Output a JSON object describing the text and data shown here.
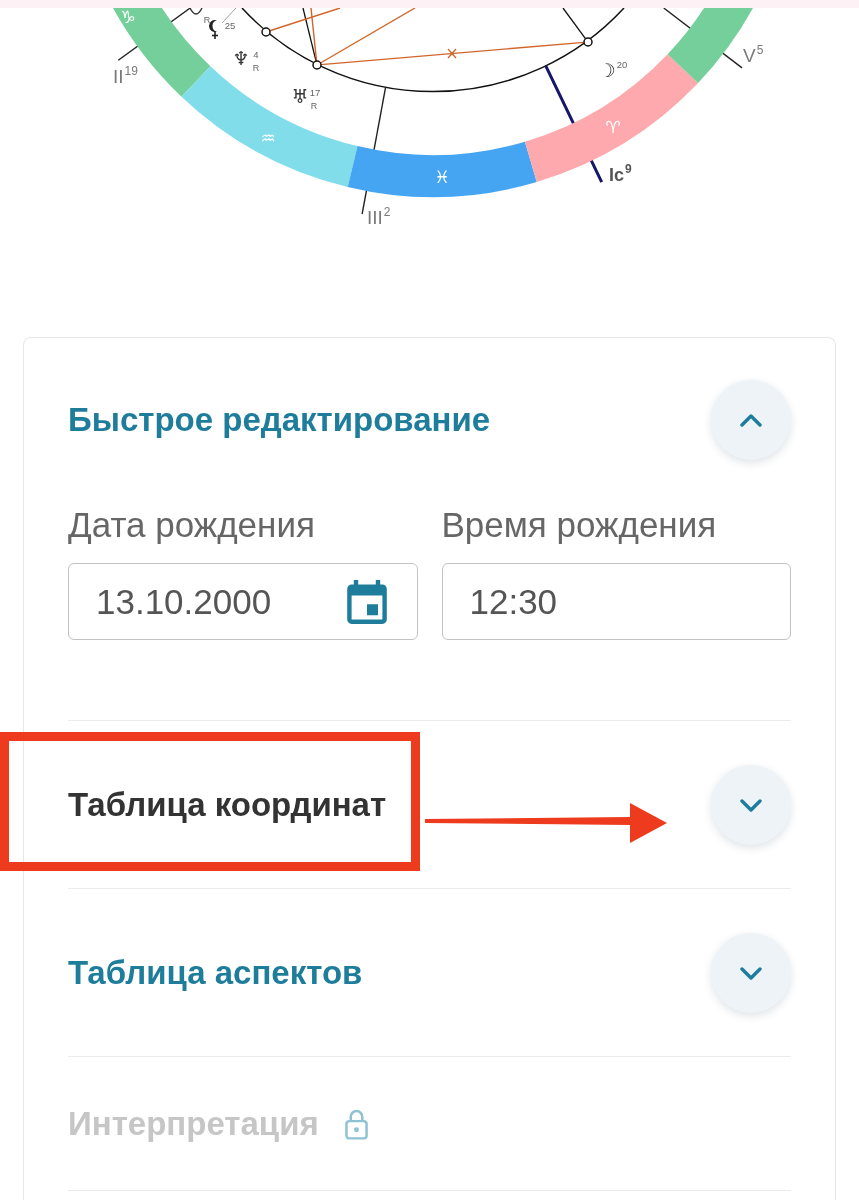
{
  "natal_chart": {
    "zodiac_signs": [
      {
        "glyph": "♑",
        "color": "#74cf9b"
      },
      {
        "glyph": "♒",
        "color": "#80dde9"
      },
      {
        "glyph": "♓",
        "color": "#45a5f3"
      },
      {
        "glyph": "♈",
        "color": "#fea9ad"
      },
      {
        "color": "#74cf9b"
      }
    ],
    "house_cusps": [
      {
        "label": "II",
        "degree": "19",
        "kind": "house"
      },
      {
        "label": "III",
        "degree": "2",
        "kind": "house"
      },
      {
        "label": "Ic",
        "degree": "9",
        "kind": "angle"
      },
      {
        "label": "V",
        "degree": "5",
        "kind": "house"
      }
    ],
    "planets": [
      {
        "kind": "cut",
        "retrograde_mark": "R"
      },
      {
        "kind": "lilith",
        "degree": "25"
      },
      {
        "kind": "glyph",
        "glyph": "♆",
        "degree": "4",
        "retrograde_mark": "R"
      },
      {
        "kind": "glyph",
        "glyph": "♅",
        "degree": "17",
        "retrograde_mark": "R"
      },
      {
        "kind": "glyph",
        "glyph": "☽",
        "degree": "20"
      }
    ]
  },
  "sections": [
    {
      "title": "Быстрое редактирование",
      "expanded": true,
      "selected": false,
      "locked": false,
      "highlighted": false,
      "fields": [
        {
          "kind": "date",
          "label": "Дата рождения",
          "value": "13.10.2000"
        },
        {
          "kind": "time",
          "label": "Время рождения",
          "value": "12:30"
        }
      ]
    },
    {
      "title": "Таблица координат",
      "expanded": false,
      "selected": true,
      "locked": false,
      "highlighted": true
    },
    {
      "title": "Таблица аспектов",
      "expanded": false,
      "selected": false,
      "locked": false,
      "highlighted": false
    },
    {
      "title": "Интерпретация",
      "selected": false,
      "locked": true,
      "highlighted": false
    }
  ]
}
